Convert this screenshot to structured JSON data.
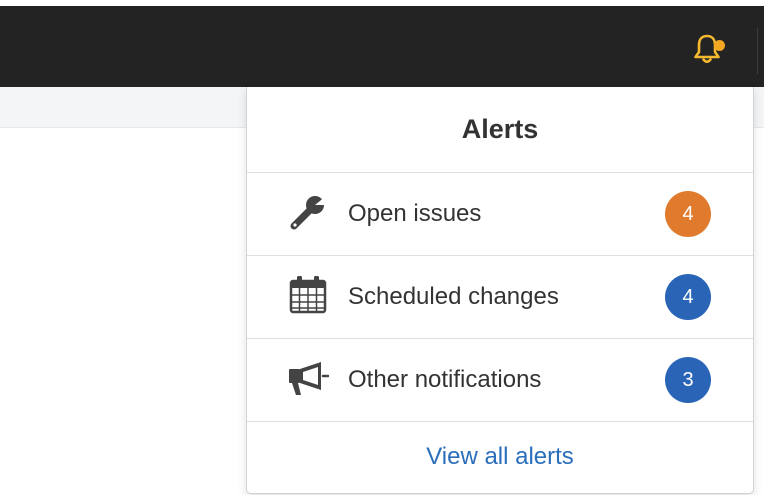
{
  "topbar": {
    "bell_icon": "bell-icon",
    "bell_color": "#f5b82e",
    "notification_dot_color": "#f5a623"
  },
  "alerts": {
    "title": "Alerts",
    "items": [
      {
        "label": "Open issues",
        "count": "4",
        "icon": "wrench-icon",
        "badge_color": "#e07b2e"
      },
      {
        "label": "Scheduled changes",
        "count": "4",
        "icon": "calendar-icon",
        "badge_color": "#2a64b7"
      },
      {
        "label": "Other notifications",
        "count": "3",
        "icon": "megaphone-icon",
        "badge_color": "#2a64b7"
      }
    ],
    "view_all": "View all alerts",
    "link_color": "#2a6ebb"
  }
}
